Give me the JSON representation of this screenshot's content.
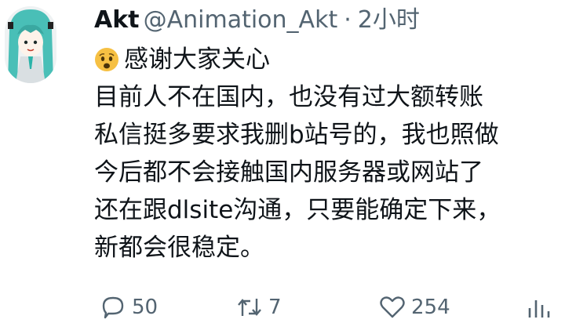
{
  "author": {
    "name": "Akt",
    "handle": "@Animation_Akt",
    "separator": "·",
    "time": "2小时"
  },
  "post": {
    "emoji": "worried-face",
    "lines": [
      "感谢大家关心",
      "目前人不在国内，也没有过大额转账",
      "私信挺多要求我删b站号的，我也照做",
      "今后都不会接触国内服务器或网站了",
      "还在跟dlsite沟通，只要能确定下来，",
      "新都会很稳定。"
    ]
  },
  "actions": {
    "replies": "50",
    "reposts": "7",
    "likes": "254",
    "views_icon": "bar-chart-icon"
  },
  "colors": {
    "text": "#0f1419",
    "secondary": "#536471",
    "emoji_face": "#f6c043"
  }
}
